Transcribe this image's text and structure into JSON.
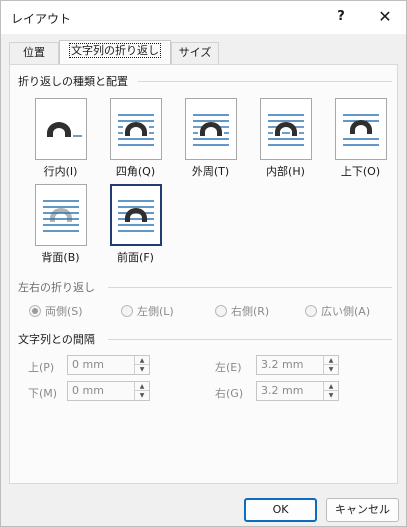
{
  "window": {
    "title": "レイアウト",
    "help_label": "?",
    "close_label": "✕"
  },
  "tabs": [
    {
      "label": "位置"
    },
    {
      "label": "文字列の折り返し"
    },
    {
      "label": "サイズ"
    }
  ],
  "wrap_section": {
    "title": "折り返しの種類と配置",
    "options": [
      {
        "label": "行内(I)",
        "icon": "inline-wrap-icon"
      },
      {
        "label": "四角(Q)",
        "icon": "square-wrap-icon"
      },
      {
        "label": "外周(T)",
        "icon": "tight-wrap-icon"
      },
      {
        "label": "内部(H)",
        "icon": "through-wrap-icon"
      },
      {
        "label": "上下(O)",
        "icon": "top-bottom-wrap-icon"
      },
      {
        "label": "背面(B)",
        "icon": "behind-text-icon"
      },
      {
        "label": "前面(F)",
        "icon": "in-front-of-text-icon",
        "selected": true
      }
    ]
  },
  "side_section": {
    "title": "左右の折り返し",
    "options": [
      {
        "label": "両側(S)",
        "checked": true
      },
      {
        "label": "左側(L)",
        "checked": false
      },
      {
        "label": "右側(R)",
        "checked": false
      },
      {
        "label": "広い側(A)",
        "checked": false
      }
    ]
  },
  "distance_section": {
    "title": "文字列との間隔",
    "top": {
      "label": "上(P)",
      "value": "0 mm"
    },
    "bottom": {
      "label": "下(M)",
      "value": "0 mm"
    },
    "left": {
      "label": "左(E)",
      "value": "3.2 mm"
    },
    "right": {
      "label": "右(G)",
      "value": "3.2 mm"
    }
  },
  "buttons": {
    "ok_label": "OK",
    "cancel_label": "キャンセル"
  },
  "colors": {
    "accent": "#0f6cbd",
    "line": "#2e75b6",
    "shape": "#2f2f2f",
    "selected_border": "#1f3d73"
  }
}
